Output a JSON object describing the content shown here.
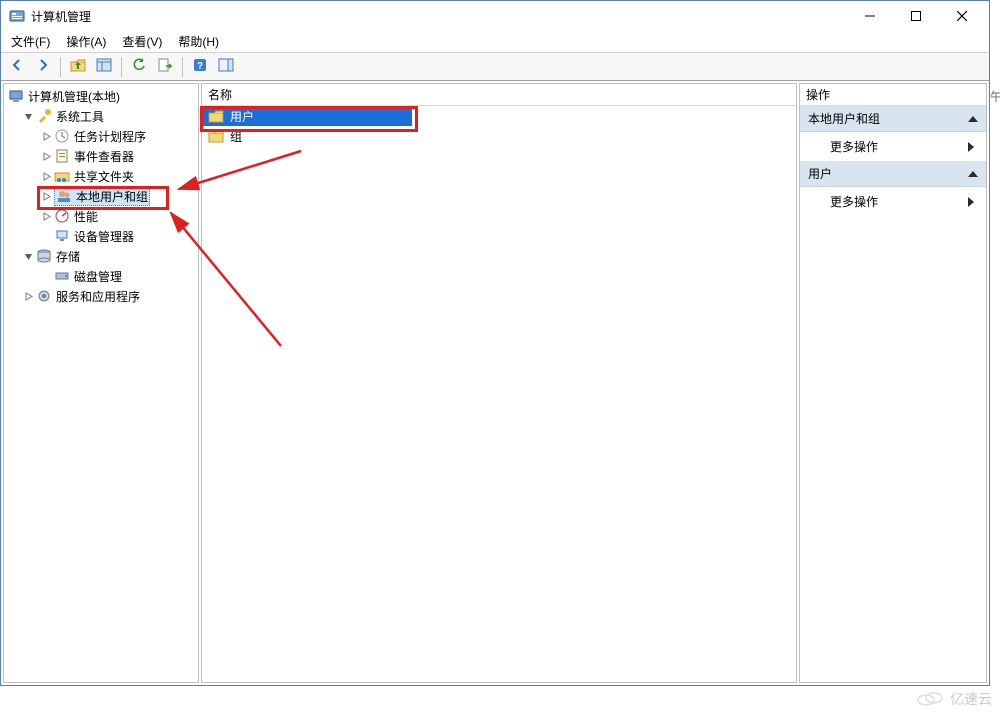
{
  "window": {
    "title": "计算机管理"
  },
  "menu": {
    "file": "文件(F)",
    "action": "操作(A)",
    "view": "查看(V)",
    "help": "帮助(H)"
  },
  "toolbar_icons": {
    "back": "back-icon",
    "forward": "forward-icon",
    "up": "up-icon",
    "show_hide": "show-hide-icon",
    "refresh": "refresh-icon",
    "export": "export-icon",
    "help": "help-icon",
    "preview": "preview-icon"
  },
  "tree": {
    "root": "计算机管理(本地)",
    "system_tools": "系统工具",
    "task_scheduler": "任务计划程序",
    "event_viewer": "事件查看器",
    "shared_folders": "共享文件夹",
    "local_users_groups": "本地用户和组",
    "performance": "性能",
    "device_manager": "设备管理器",
    "storage": "存储",
    "disk_management": "磁盘管理",
    "services_apps": "服务和应用程序"
  },
  "center": {
    "column_name": "名称",
    "items": {
      "users": "用户",
      "groups": "组"
    }
  },
  "actions": {
    "header": "操作",
    "section1": "本地用户和组",
    "more_actions": "更多操作",
    "section2": "用户"
  },
  "rightedge": "午",
  "watermark": "亿速云"
}
